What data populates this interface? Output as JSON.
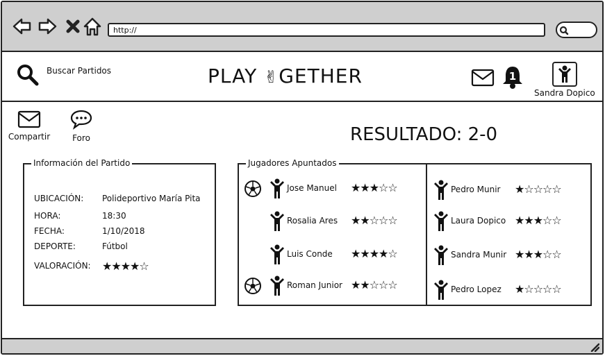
{
  "browser": {
    "url": "http://"
  },
  "header": {
    "search_label": "Buscar Partidos",
    "logo_left": "PLAY",
    "logo_hand": "✌",
    "logo_right": "GETHER",
    "notification_count": "1",
    "user_name": "Sandra Dopico"
  },
  "actions": {
    "share_label": "Compartir",
    "forum_label": "Foro"
  },
  "result": "RESULTADO: 2-0",
  "match_info": {
    "title": "Información del Partido",
    "rows": [
      {
        "key": "UBICACIÓN:",
        "value": "Polideportivo  María Pita"
      },
      {
        "key": "HORA:",
        "value": "18:30"
      },
      {
        "key": "FECHA:",
        "value": "1/10/2018"
      },
      {
        "key": "DEPORTE:",
        "value": "Fútbol"
      },
      {
        "key": "VALORACIÓN:",
        "value": "★★★★☆"
      }
    ],
    "rating": 4
  },
  "players": {
    "title": "Jugadores Apuntados",
    "left": [
      {
        "name": "Jose Manuel",
        "stars": "★★★☆☆",
        "rating": 3,
        "scored": true
      },
      {
        "name": "Rosalia Ares",
        "stars": "★★☆☆☆",
        "rating": 2,
        "scored": false
      },
      {
        "name": "Luis Conde",
        "stars": "★★★★☆",
        "rating": 4,
        "scored": false
      },
      {
        "name": "Roman Junior",
        "stars": "★★☆☆☆",
        "rating": 2,
        "scored": true
      }
    ],
    "right": [
      {
        "name": "Pedro Munir",
        "stars": "★☆☆☆☆",
        "rating": 1
      },
      {
        "name": "Laura Dopico",
        "stars": "★★★☆☆",
        "rating": 3
      },
      {
        "name": "Sandra Munir",
        "stars": "★★★☆☆",
        "rating": 3
      },
      {
        "name": "Pedro Lopez",
        "stars": "★☆☆☆☆",
        "rating": 1
      }
    ]
  },
  "colors": {
    "chrome": "#cfcfcf",
    "ink": "#222222"
  }
}
